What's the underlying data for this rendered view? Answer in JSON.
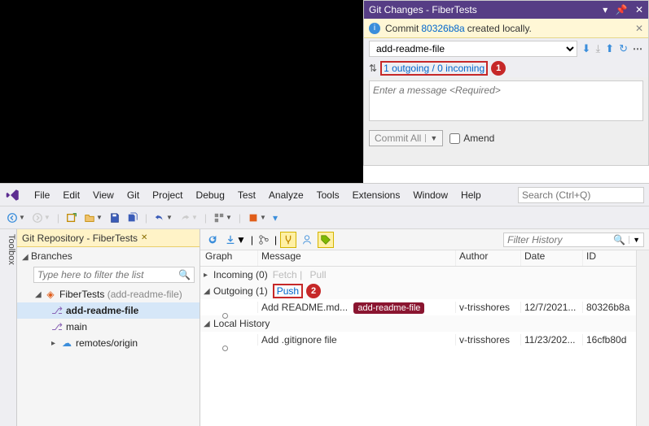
{
  "gitChanges": {
    "title": "Git Changes - FiberTests",
    "info_prefix": " Commit ",
    "info_commit": "80326b8a",
    "info_suffix": " created locally.",
    "branch": "add-readme-file",
    "outgoingIncoming": "1 outgoing / 0 incoming",
    "callout1": "1",
    "messagePlaceholder": "Enter a message <Required>",
    "commitBtn": "Commit All",
    "amend": "Amend"
  },
  "menu": [
    "File",
    "Edit",
    "View",
    "Git",
    "Project",
    "Debug",
    "Test",
    "Analyze",
    "Tools",
    "Extensions",
    "Window",
    "Help"
  ],
  "searchPlaceholder": "Search (Ctrl+Q)",
  "toolbox": "Toolbox",
  "repoTab": "Git Repository - FiberTests",
  "branchesHdr": "Branches",
  "filterPlaceholder": "Type here to filter the list",
  "tree": {
    "repo": "FiberTests",
    "repoSuffix": "(add-readme-file)",
    "b1": "add-readme-file",
    "b2": "main",
    "remotes": "remotes/origin"
  },
  "historyFilter": "Filter History",
  "cols": {
    "graph": "Graph",
    "message": "Message",
    "author": "Author",
    "date": "Date",
    "id": "ID"
  },
  "sections": {
    "incoming": "Incoming (0)",
    "fetch": "Fetch",
    "pull": "Pull",
    "outgoing": "Outgoing (1)",
    "push": "Push",
    "callout2": "2",
    "local": "Local History"
  },
  "commits": [
    {
      "msg": "Add README.md...",
      "badge": "add-readme-file",
      "author": "v-trisshores",
      "date": "12/7/2021...",
      "id": "80326b8a"
    },
    {
      "msg": "Add .gitignore file",
      "badge": "",
      "author": "v-trisshores",
      "date": "11/23/202...",
      "id": "16cfb80d"
    }
  ]
}
